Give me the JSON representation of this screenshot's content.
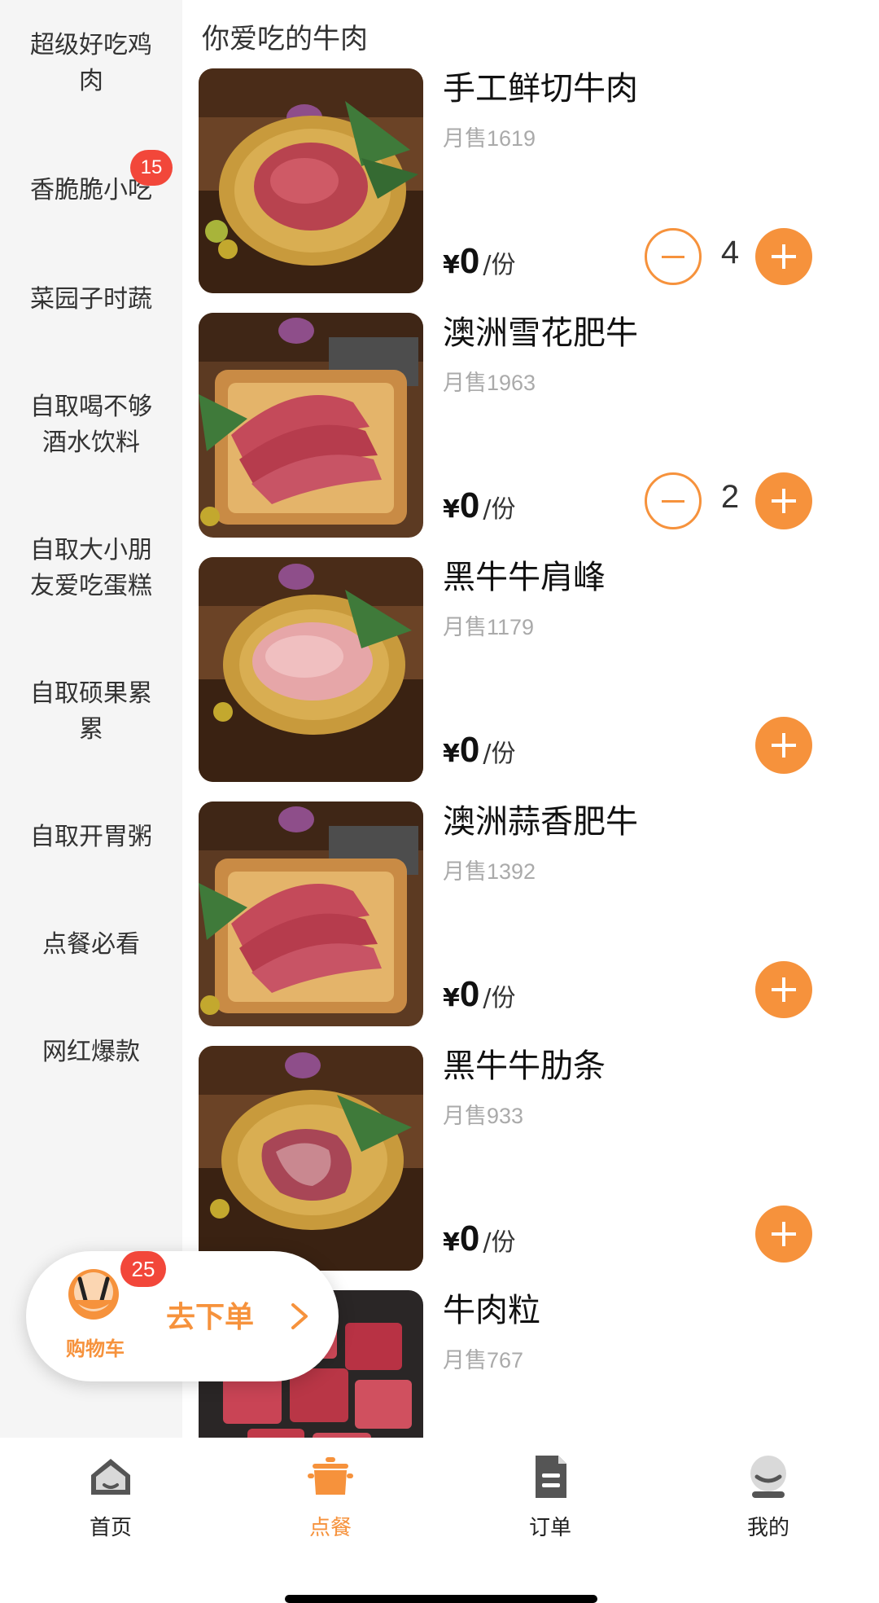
{
  "sidebar": {
    "categories": [
      {
        "label": "超级好吃鸡肉",
        "line1": "超级好吃鸡",
        "line2": "肉"
      },
      {
        "label": "香脆脆小吃",
        "line1": "香脆脆小吃",
        "line2": "",
        "badge": "15"
      },
      {
        "label": "菜园子时蔬",
        "line1": "菜园子时蔬",
        "line2": ""
      },
      {
        "label": "自取喝不够酒水饮料",
        "line1": "自取喝不够",
        "line2": "酒水饮料"
      },
      {
        "label": "自取大小朋友爱吃蛋糕",
        "line1": "自取大小朋",
        "line2": "友爱吃蛋糕"
      },
      {
        "label": "自取硕果累累",
        "line1": "自取硕果累",
        "line2": "累"
      },
      {
        "label": "自取开胃粥",
        "line1": "自取开胃粥",
        "line2": ""
      },
      {
        "label": "点餐必看",
        "line1": "点餐必看",
        "line2": ""
      },
      {
        "label": "网红爆款",
        "line1": "网红爆款",
        "line2": ""
      }
    ]
  },
  "section": {
    "title": "你爱吃的牛肉"
  },
  "products": [
    {
      "name": "手工鲜切牛肉",
      "sales": "月售1619",
      "currency": "¥",
      "price": "0",
      "unit": "/份",
      "qty": "4",
      "image": "beef-minced-plate"
    },
    {
      "name": "澳洲雪花肥牛",
      "sales": "月售1963",
      "currency": "¥",
      "price": "0",
      "unit": "/份",
      "qty": "2",
      "image": "beef-slices-board"
    },
    {
      "name": "黑牛牛肩峰",
      "sales": "月售1179",
      "currency": "¥",
      "price": "0",
      "unit": "/份",
      "qty": "",
      "image": "beef-thin-plate"
    },
    {
      "name": "澳洲蒜香肥牛",
      "sales": "月售1392",
      "currency": "¥",
      "price": "0",
      "unit": "/份",
      "qty": "",
      "image": "beef-slices-board"
    },
    {
      "name": "黑牛牛肋条",
      "sales": "月售933",
      "currency": "¥",
      "price": "0",
      "unit": "/份",
      "qty": "",
      "image": "beef-strips-plate"
    },
    {
      "name": "牛肉粒",
      "sales": "月售767",
      "currency": "",
      "price": "",
      "unit": "",
      "qty": "",
      "image": "beef-cubes"
    }
  ],
  "cart": {
    "label": "购物车",
    "count": "25",
    "go_label": "去下单"
  },
  "tabbar": {
    "items": [
      {
        "label": "首页",
        "icon": "home-icon"
      },
      {
        "label": "点餐",
        "icon": "pot-icon",
        "active": true
      },
      {
        "label": "订单",
        "icon": "document-icon"
      },
      {
        "label": "我的",
        "icon": "profile-icon"
      }
    ]
  },
  "colors": {
    "accent": "#f6923c",
    "badge": "#f2473a",
    "sidebar_bg": "#f5f5f5"
  }
}
